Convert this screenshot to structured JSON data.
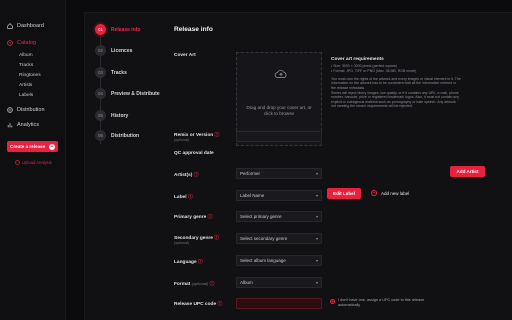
{
  "sidebar": {
    "items": [
      {
        "label": "Dashboard",
        "icon": "home-icon"
      },
      {
        "label": "Catalog",
        "icon": "music-icon",
        "active": true
      },
      {
        "label": "Distribution",
        "icon": "globe-icon"
      },
      {
        "label": "Analytics",
        "icon": "chart-icon"
      }
    ],
    "catalog_sub": [
      "Album",
      "Tracks",
      "Ringtones",
      "Artists",
      "Labels"
    ],
    "create_button": "Create a release",
    "inbox_link": "Upload Analysis"
  },
  "stepper": [
    {
      "num": "01",
      "label": "Release info",
      "active": true
    },
    {
      "num": "02",
      "label": "Licences"
    },
    {
      "num": "03",
      "label": "Tracks"
    },
    {
      "num": "04",
      "label": "Preview & Distribute"
    },
    {
      "num": "05",
      "label": "History"
    },
    {
      "num": "06",
      "label": "Distribution"
    }
  ],
  "form": {
    "heading": "Release info",
    "cover_art_label": "Cover Art",
    "dropzone_text": "Drag and drop your cover art, or click to browse",
    "requirements": {
      "title": "Cover art requirements",
      "bullets": [
        "Size: 3000 × 3000 pixels (perfect square)",
        "Format: JPG, TIFF or PNG (Max. 36 MB, RGB mode)"
      ],
      "paragraphs": [
        "You must own the rights of the artwork and every images or visual element in it. The information on the artwork has to be consistent with all the information entered in the release metadata.",
        "Stores will reject blurry images, low quality, or if it contains any URL, e-mail, phone number, barcode, price or registered trademark logos. Also, it must not contain any explicit or outrageous material such as pornography or hate speech. Any artwork not meeting the stores' requirements will be rejected."
      ]
    },
    "remix_label": "Remix or Version",
    "remix_hint": "(optional)",
    "qc_label": "QC approval date",
    "artist_label": "Artist(s)",
    "artist_value": "Performer",
    "add_artist": "Add Artist",
    "label_label": "Label",
    "label_value": "Label Name",
    "edit_label": "Edit Label",
    "add_new_label": "Add new label",
    "primary_genre_label": "Primary genre",
    "primary_genre_value": "Select primary genre",
    "secondary_genre_label": "Secondary genre",
    "secondary_genre_hint": "(optional)",
    "secondary_genre_value": "Select secondary genre",
    "language_label": "Language",
    "language_value": "Select album language",
    "format_label": "Format",
    "format_hint": "(optional)",
    "format_value": "Album",
    "upc_label": "Release UPC code",
    "upc_radio_text": "I don't have one, assign a UPC code to this release automatically"
  },
  "colors": {
    "accent": "#e8213f",
    "background": "#0b0b0d",
    "panel": "#111114"
  }
}
